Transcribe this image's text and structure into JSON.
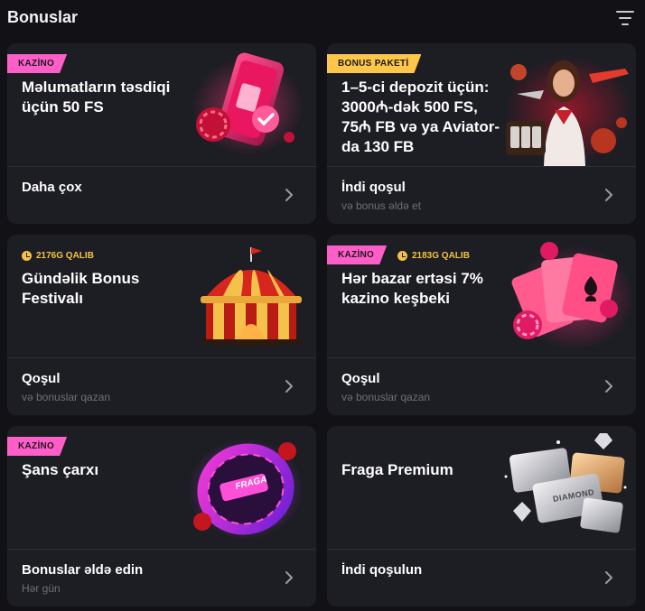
{
  "header": {
    "title": "Bonuslar",
    "filter_icon": "filter-icon"
  },
  "cards": [
    {
      "badge": "KAZİNO",
      "badge_color": "#ff5ec8",
      "title": "Məlumatların təsdiqi üçün 50 FS",
      "action_label": "Daha çox",
      "action_sub": "",
      "art_icon": "phone-sim-card-icon"
    },
    {
      "badge": "BONUS PAKETİ",
      "badge_color": "#ffc64a",
      "title": "1–5-ci depozit üçün: 3000₼-dək 500 FS, 75₼ FB və ya Aviator-da 130 FB",
      "action_label": "İndi qoşul",
      "action_sub": "və bonus əldə et",
      "art_icon": "woman-aviator-slots-icon"
    },
    {
      "prize": "2176G QALIB",
      "title": "Gündəlik Bonus Festivalı",
      "action_label": "Qoşul",
      "action_sub": "və bonuslar qazan",
      "art_icon": "circus-tent-icon"
    },
    {
      "badge": "KAZİNO",
      "badge_color": "#ff5ec8",
      "prize": "2183G QALIB",
      "title": "Hər bazar ertəsi 7% kazino keşbeki",
      "action_label": "Qoşul",
      "action_sub": "və bonuslar qazan",
      "art_icon": "playing-cards-chips-icon"
    },
    {
      "badge": "KAZİNO",
      "badge_color": "#ff5ec8",
      "title": "Şans çarxı",
      "action_label": "Bonuslar əldə edin",
      "action_sub": "Hər gün",
      "art_icon": "fortune-wheel-icon",
      "art_text": "FRAGA"
    },
    {
      "title": "Fraga Premium",
      "action_label": "İndi qoşulun",
      "action_sub": "",
      "art_icon": "premium-cards-icon",
      "art_text": "DIAMOND"
    }
  ]
}
